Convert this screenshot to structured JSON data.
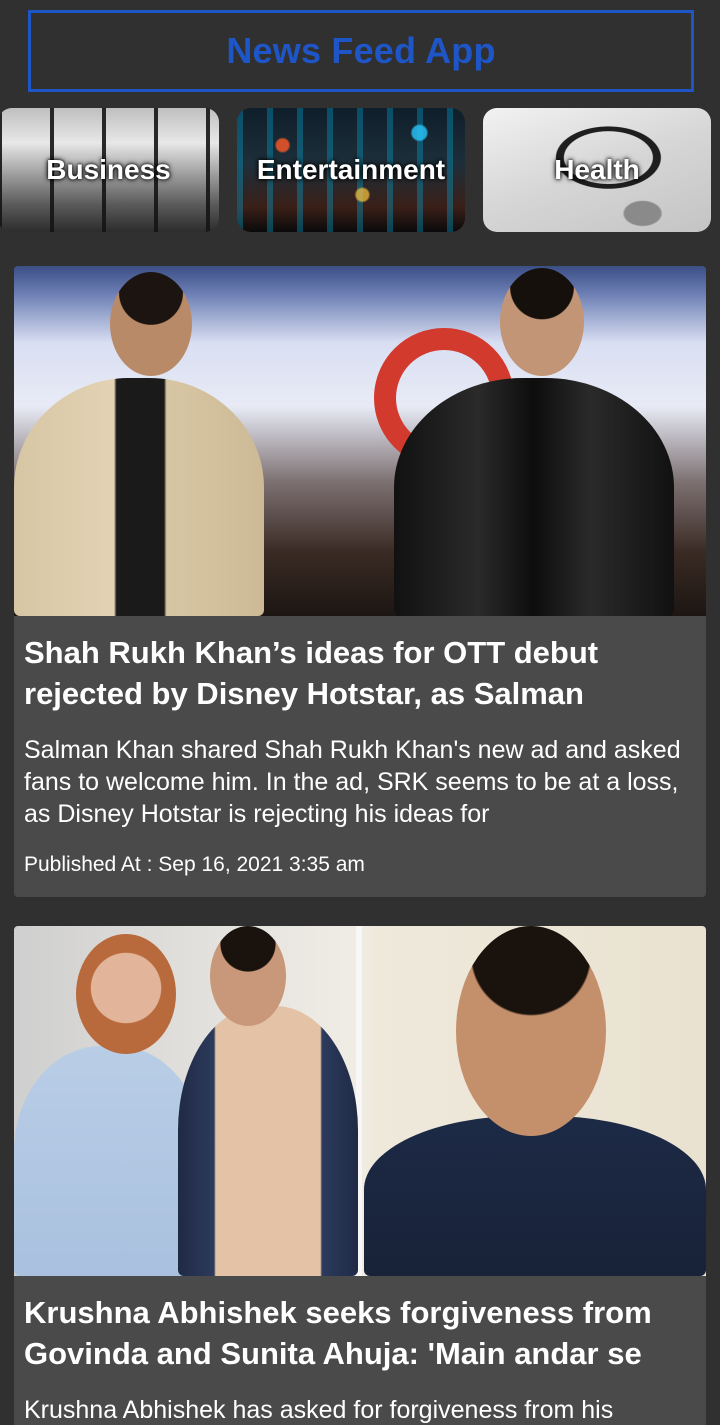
{
  "app": {
    "title": "News Feed App",
    "accent_color": "#1e56c8",
    "background_color": "#303030"
  },
  "categories": [
    {
      "label": "Business",
      "image": "city-skyline-office-photo"
    },
    {
      "label": "Entertainment",
      "image": "neon-city-night-photo"
    },
    {
      "label": "Health",
      "image": "stethoscope-photo"
    }
  ],
  "articles": [
    {
      "image": "two-men-on-stage-photo",
      "title": "Shah Rukh Khan’s ideas for OTT debut rejected by Disney Hotstar, as Salman",
      "description": "Salman Khan shared Shah Rukh Khan's new ad and asked fans to welcome him. In the ad, SRK seems to be at a loss, as Disney Hotstar is rejecting his ideas for",
      "published": "Published At : Sep 16, 2021 3:35 am"
    },
    {
      "image": "celebrity-collage-photo",
      "title": "Krushna Abhishek seeks forgiveness from Govinda and Sunita Ahuja: 'Main andar se",
      "description": "Krushna Abhishek has asked for forgiveness from his",
      "published": ""
    }
  ]
}
